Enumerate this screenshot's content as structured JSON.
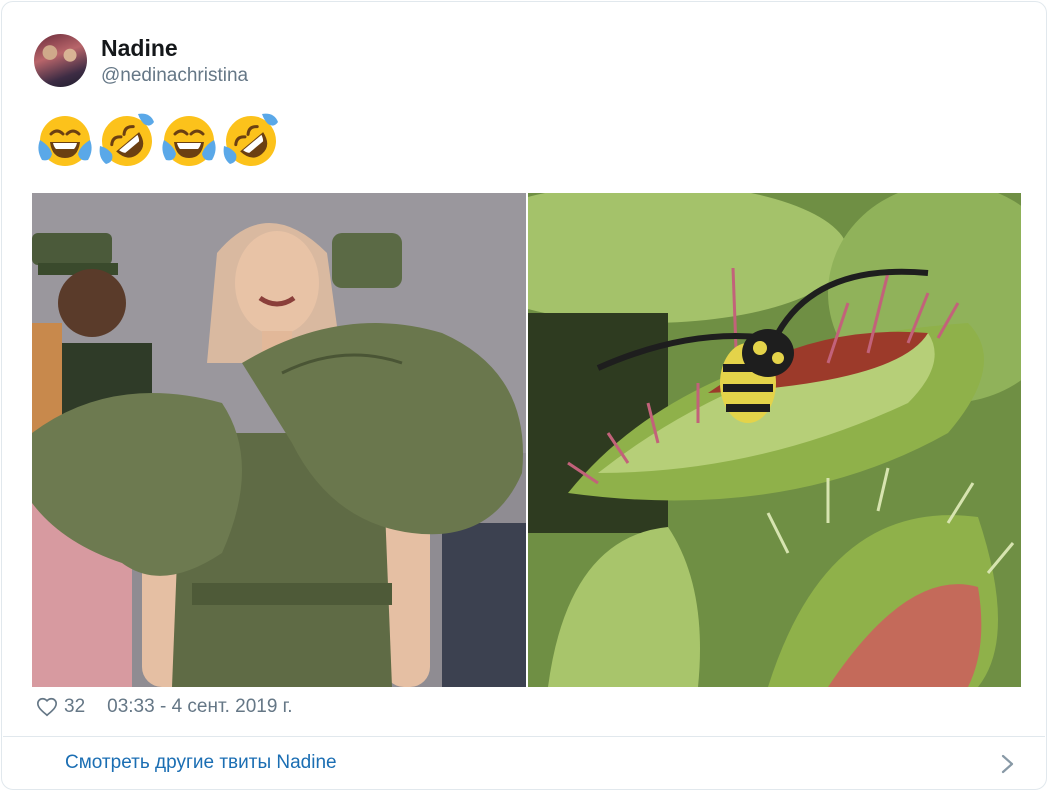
{
  "tweet": {
    "author_name": "Nadine",
    "author_handle": "@nedinachristina",
    "emojis": [
      "face-with-tears-of-joy",
      "rolling-on-the-floor-laughing",
      "face-with-tears-of-joy",
      "rolling-on-the-floor-laughing"
    ],
    "images": [
      {
        "subject": "woman in olive green dress with large ruffled shoulders"
      },
      {
        "subject": "wasp caught in a Venus flytrap"
      }
    ],
    "like_count": "32",
    "timestamp": "03:33 - 4 сент. 2019 г."
  },
  "footer": {
    "more_tweets_label": "Смотреть другие твиты Nadine"
  },
  "colors": {
    "link": "#1b6eb3",
    "muted": "#657786",
    "border": "#e1e8ed",
    "olive": "#5d6b45",
    "flytrap_green": "#8fb14a"
  }
}
